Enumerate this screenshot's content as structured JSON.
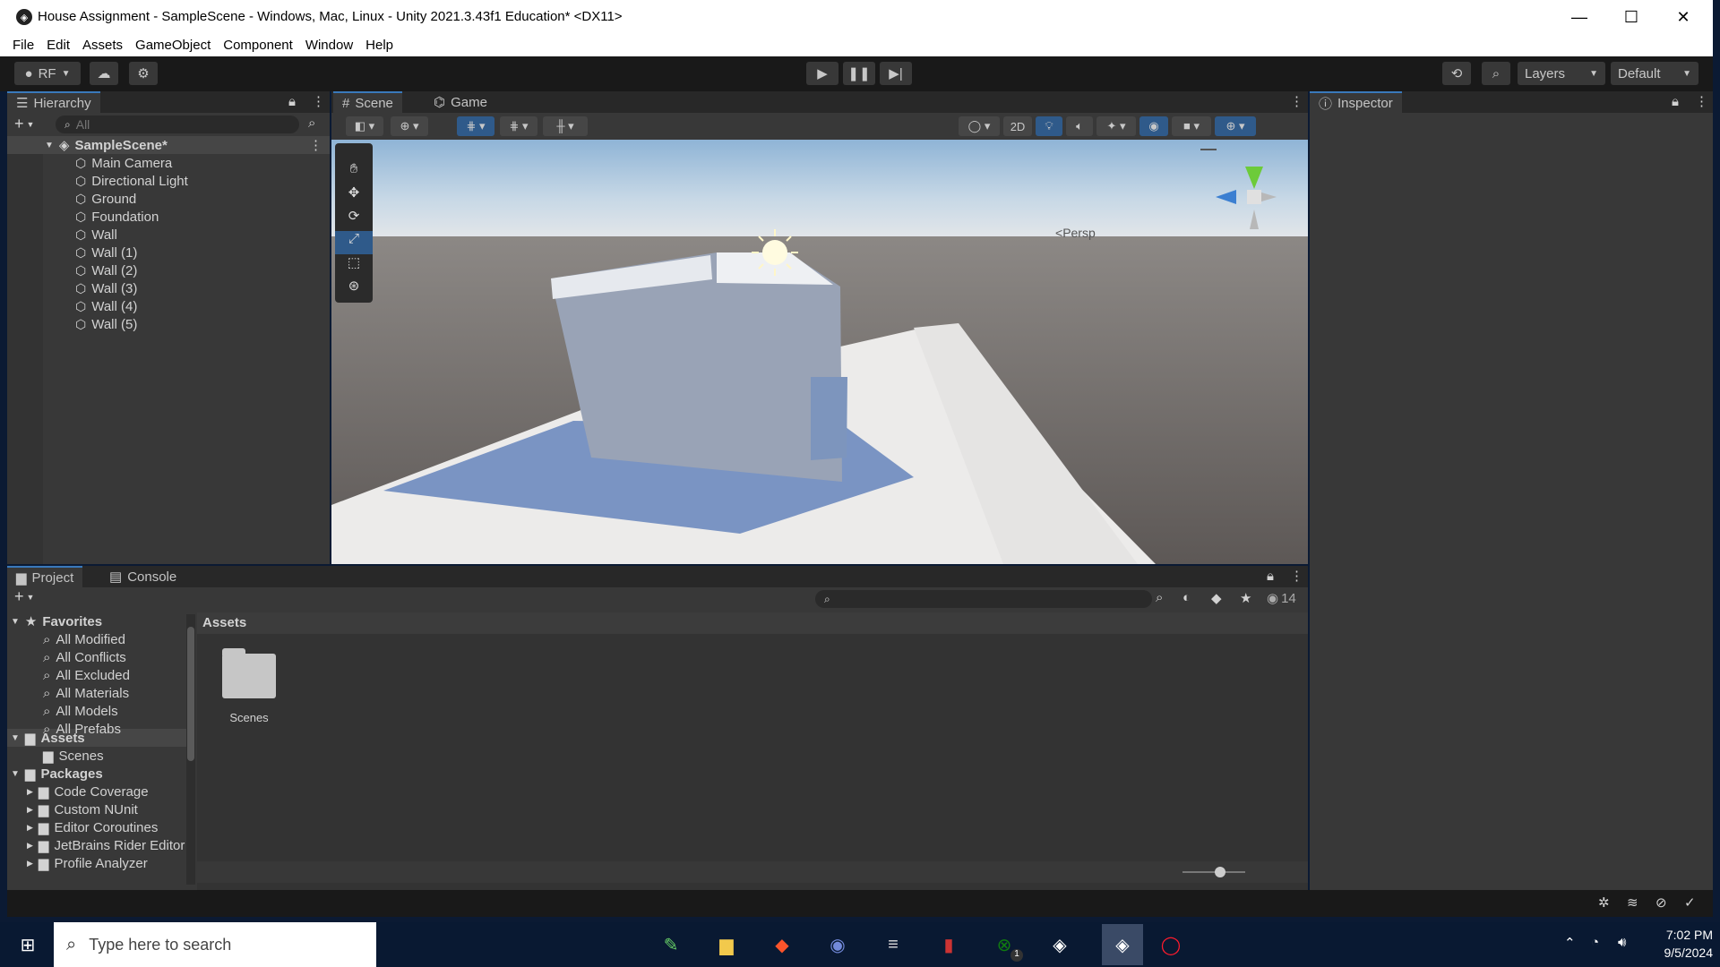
{
  "window": {
    "title": "House Assignment - SampleScene - Windows, Mac, Linux - Unity 2021.3.43f1 Education* <DX11>"
  },
  "menu": [
    "File",
    "Edit",
    "Assets",
    "GameObject",
    "Component",
    "Window",
    "Help"
  ],
  "toolbar": {
    "account": "RF",
    "layers": "Layers",
    "layout": "Default"
  },
  "hierarchy": {
    "tab": "Hierarchy",
    "search_placeholder": "All",
    "scene": "SampleScene*",
    "items": [
      "Main Camera",
      "Directional Light",
      "Ground",
      "Foundation",
      "Wall",
      "Wall (1)",
      "Wall (2)",
      "Wall (3)",
      "Wall (4)",
      "Wall (5)"
    ]
  },
  "scene_view": {
    "tabs": [
      "Scene",
      "Game"
    ],
    "toggle_2d": "2D",
    "persp": "Persp"
  },
  "inspector": {
    "tab": "Inspector"
  },
  "project": {
    "tabs": [
      "Project",
      "Console"
    ],
    "visible_count": "14",
    "favorites_label": "Favorites",
    "favorites": [
      "All Modified",
      "All Conflicts",
      "All Excluded",
      "All Materials",
      "All Models",
      "All Prefabs"
    ],
    "assets_label": "Assets",
    "assets_children": [
      "Scenes"
    ],
    "packages_label": "Packages",
    "packages": [
      "Code Coverage",
      "Custom NUnit",
      "Editor Coroutines",
      "JetBrains Rider Editor",
      "Profile Analyzer"
    ],
    "breadcrumb": "Assets",
    "folder_items": [
      "Scenes"
    ]
  },
  "taskbar": {
    "search_placeholder": "Type here to search",
    "time": "7:02 PM",
    "date": "9/5/2024",
    "xbox_badge": "1"
  }
}
